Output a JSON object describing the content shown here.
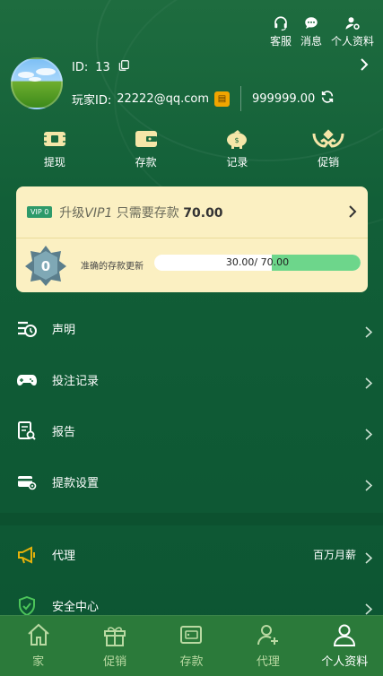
{
  "header": {
    "actions": [
      {
        "label": "客服",
        "icon": "headset-icon"
      },
      {
        "label": "消息",
        "icon": "message-icon"
      },
      {
        "label": "个人资料",
        "icon": "user-settings-icon"
      }
    ]
  },
  "profile": {
    "id_label": "ID:",
    "id_value": "13",
    "account_label": "玩家ID:",
    "account_value": "22222@qq.com",
    "balance": "999999.00"
  },
  "quick_actions": [
    {
      "label": "提现",
      "icon": "withdraw-icon"
    },
    {
      "label": "存款",
      "icon": "wallet-icon"
    },
    {
      "label": "记录",
      "icon": "piggy-bank-icon"
    },
    {
      "label": "促销",
      "icon": "promotion-icon"
    }
  ],
  "vip": {
    "badge": "VIP 0",
    "prefix": "升级",
    "level": "VIP1",
    "middle": " 只需要存款 ",
    "amount": "70.00",
    "progress_label": "准确的存款更新",
    "progress_text": "30.00/ 70.00",
    "progress_fraction": 0.4286
  },
  "menu": {
    "group1": [
      {
        "label": "声明",
        "icon": "statement-icon"
      },
      {
        "label": "投注记录",
        "icon": "gamepad-icon"
      },
      {
        "label": "报告",
        "icon": "report-icon"
      },
      {
        "label": "提款设置",
        "icon": "card-settings-icon"
      }
    ],
    "group2": [
      {
        "label": "代理",
        "icon": "megaphone-icon",
        "extra": "百万月薪"
      },
      {
        "label": "安全中心",
        "icon": "shield-icon"
      }
    ]
  },
  "bottom_nav": [
    {
      "label": "家",
      "icon": "home-icon",
      "active": false
    },
    {
      "label": "促销",
      "icon": "gift-icon",
      "active": false
    },
    {
      "label": "存款",
      "icon": "wallet-icon",
      "active": false
    },
    {
      "label": "代理",
      "icon": "add-user-icon",
      "active": false
    },
    {
      "label": "个人资料",
      "icon": "user-icon",
      "active": true
    }
  ],
  "colors": {
    "background": "#125f38",
    "vip_card": "#fbf0c2",
    "progress_fill": "#6dd68b",
    "bottom_nav": "#2b7a3a",
    "icon_accent": "#f5e6a8"
  }
}
